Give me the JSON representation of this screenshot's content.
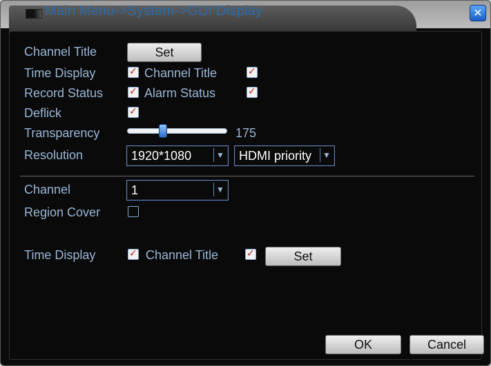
{
  "window": {
    "title": "Main Menu->System->GUI Display",
    "close_glyph": "✕"
  },
  "rows": {
    "channel_title_label": "Channel Title",
    "channel_title_set": "Set",
    "time_display_label": "Time Display",
    "channel_title_checkbox_label": "Channel Title",
    "record_status_label": "Record Status",
    "alarm_status_label": "Alarm Status",
    "deflick_label": "Deflick",
    "transparency_label": "Transparency",
    "transparency_value": "175",
    "resolution_label": "Resolution",
    "resolution_value": "1920*1080",
    "output_value": "HDMI priority",
    "channel_label": "Channel",
    "channel_value": "1",
    "region_cover_label": "Region Cover",
    "time_display_bottom_label": "Time Display",
    "channel_title_bottom_label": "Channel Title",
    "bottom_set": "Set"
  },
  "states": {
    "time_display_checked": true,
    "channel_title_checked": true,
    "record_status_checked": true,
    "alarm_status_checked": true,
    "deflick_checked": true,
    "region_cover_checked": false,
    "time_display_bottom_checked": true,
    "channel_title_bottom_checked": true,
    "transparency_fraction": 0.36
  },
  "buttons": {
    "ok": "OK",
    "cancel": "Cancel"
  },
  "colors": {
    "label_text": "#9ab6d6",
    "title_text": "#2e6aa6",
    "check_mark": "#c31f1f",
    "panel_bg": "#0a0a0a"
  }
}
